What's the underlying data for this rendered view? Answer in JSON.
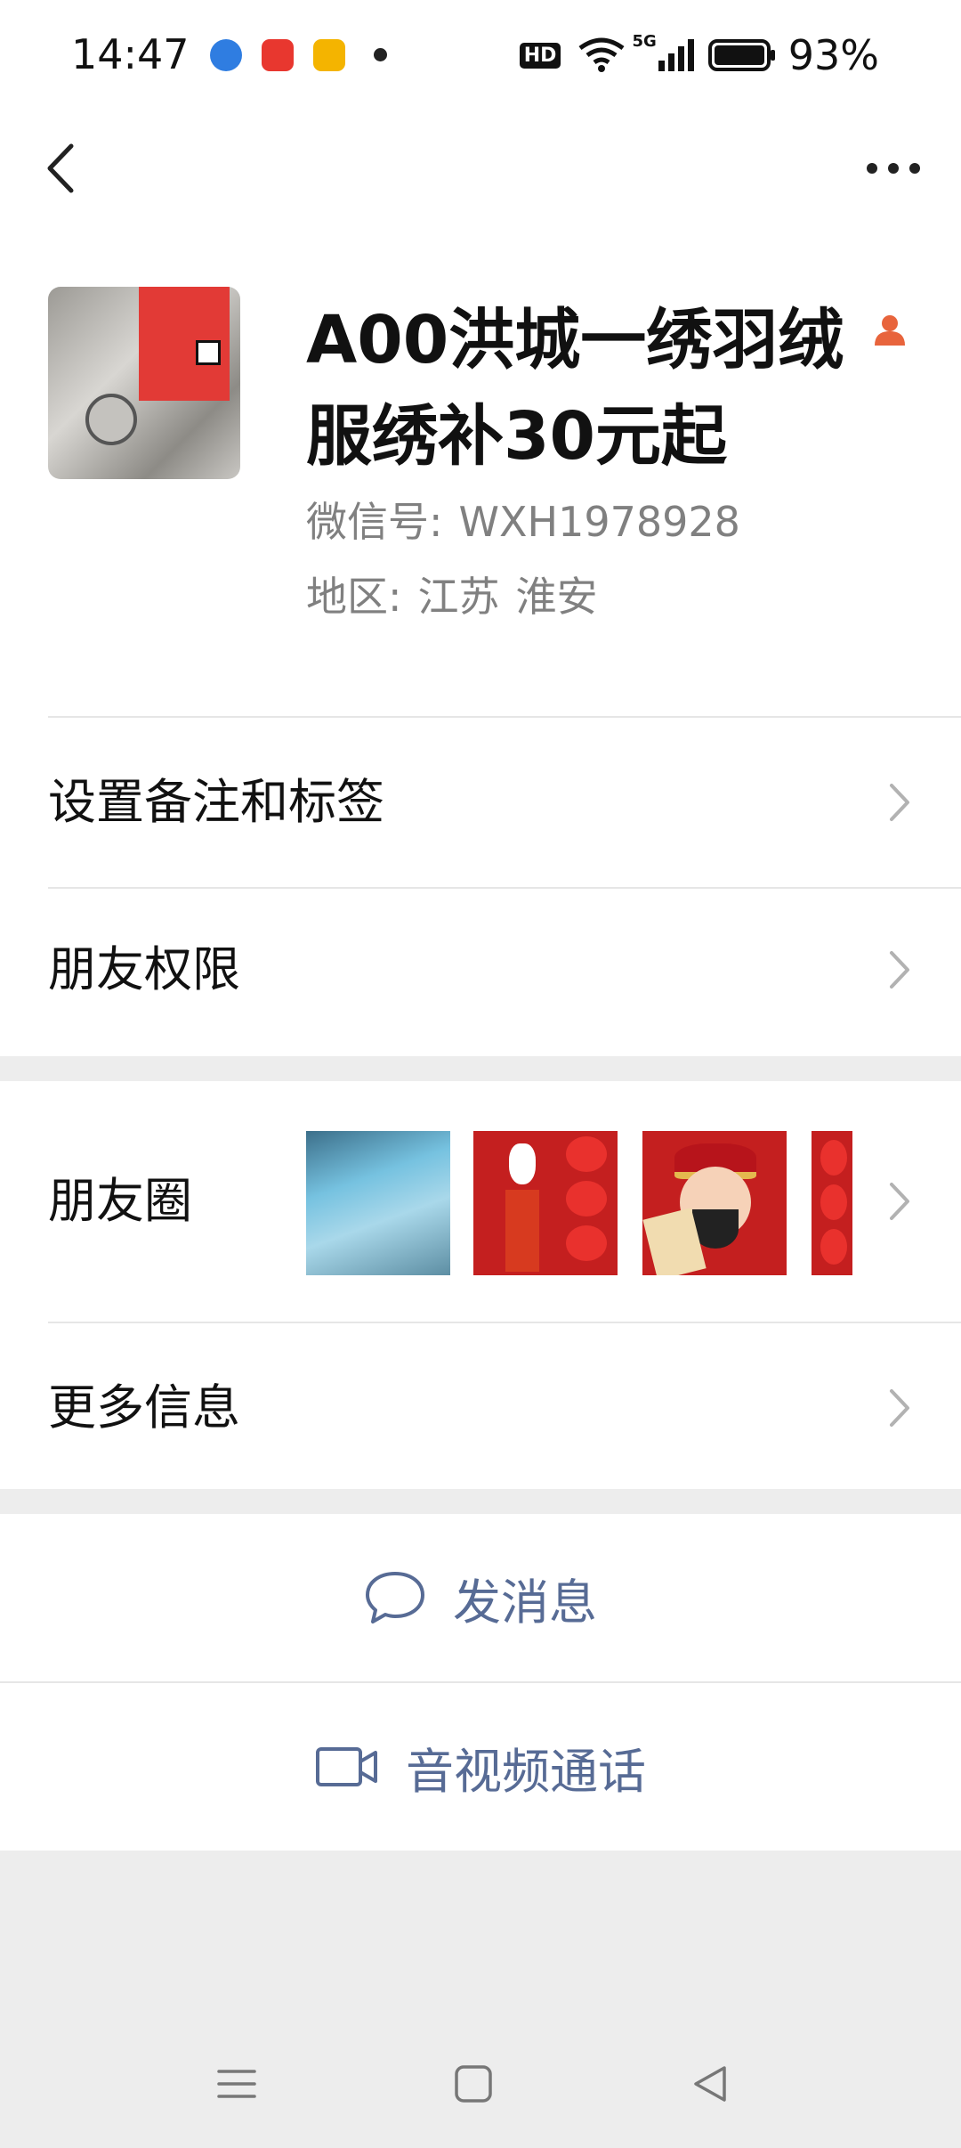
{
  "status_bar": {
    "time": "14:47",
    "hd_badge": "HD",
    "network": "5G",
    "battery": "93%",
    "app_icons": [
      "browser-app-icon",
      "map-app-icon",
      "wallet-app-icon"
    ]
  },
  "nav": {
    "back_icon": "chevron-left-icon",
    "more_icon": "ellipsis-icon"
  },
  "profile": {
    "name": "A00洪城一绣羽绒服绣补30元起",
    "badge_icon": "person-icon",
    "badge_color": "#e8643c",
    "wxid_label": "微信号:",
    "wxid": "WXH1978928",
    "region_label": "地区:",
    "region_province": "江苏",
    "region_city": "淮安"
  },
  "menu": {
    "remark_label": "设置备注和标签",
    "permission_label": "朋友权限",
    "moments_label": "朋友圈",
    "more_info_label": "更多信息"
  },
  "actions": {
    "message_label": "发消息",
    "call_label": "音视频通话",
    "link_color": "#576b95"
  },
  "colors": {
    "background": "#ededed",
    "card": "#ffffff",
    "chevron": "#b2b2b2"
  }
}
